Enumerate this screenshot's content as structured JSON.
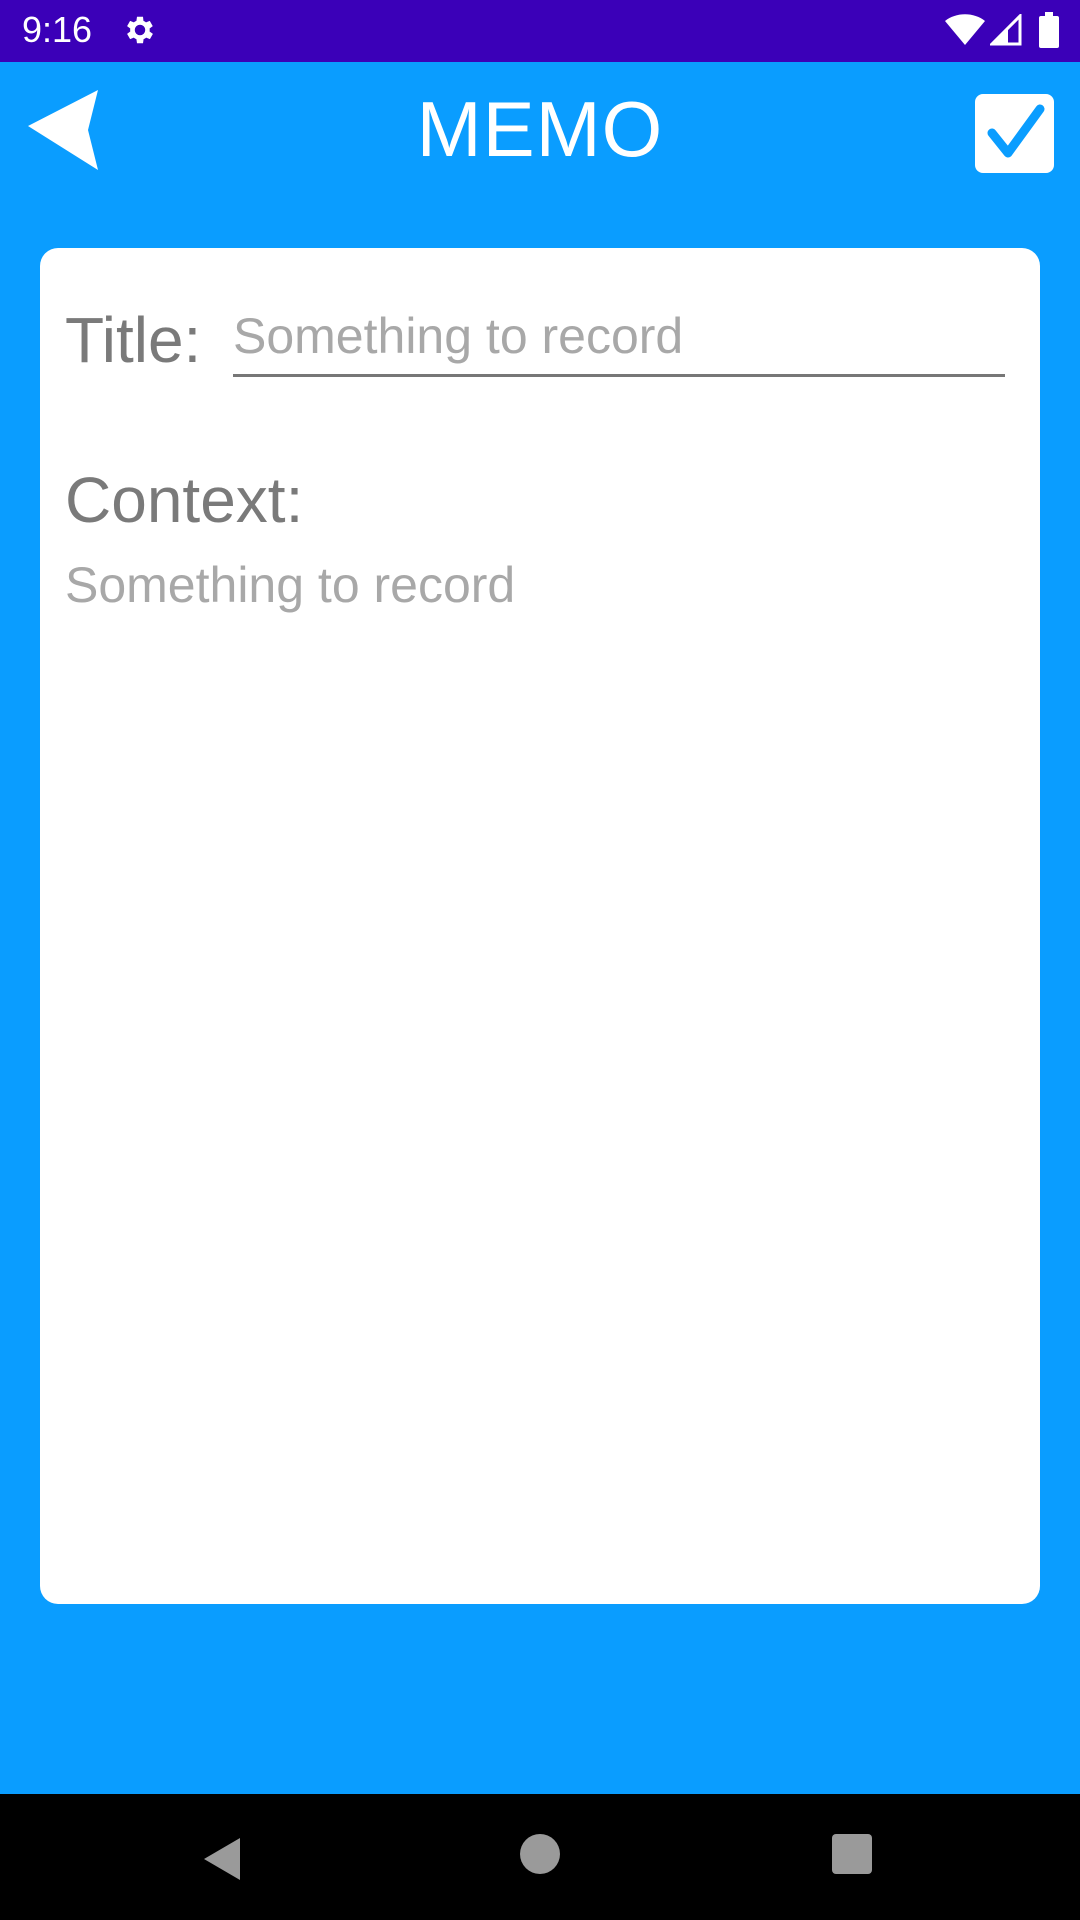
{
  "status_bar": {
    "time": "9:16",
    "icons": [
      "gear-icon",
      "wifi-icon",
      "signal-icon",
      "battery-icon"
    ]
  },
  "app_bar": {
    "title": "MEMO",
    "back_icon": "back-arrow-icon",
    "confirm_icon": "checkmark-icon"
  },
  "form": {
    "title_label": "Title:",
    "title_value": "",
    "title_placeholder": "Something to record",
    "context_label": "Context:",
    "context_value": "",
    "context_placeholder": "Something to record"
  },
  "nav_bar": {
    "icons": [
      "nav-back-icon",
      "nav-home-icon",
      "nav-recents-icon"
    ]
  },
  "colors": {
    "status_bar": "#3b00b8",
    "background": "#0a9dff",
    "card": "#ffffff",
    "label_text": "#7a7a7a",
    "placeholder_text": "#a8a8a8",
    "nav_bar": "#000000"
  }
}
